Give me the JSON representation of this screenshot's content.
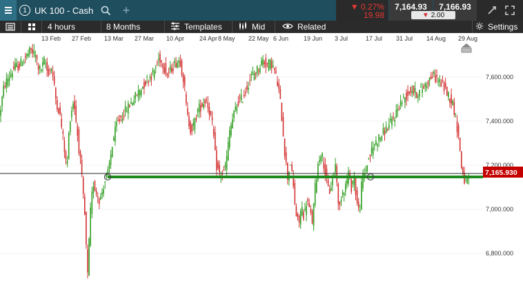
{
  "header": {
    "menu_icon": "hamburger-menu-icon",
    "instrument_number": "1",
    "instrument_name": "UK 100 - Cash",
    "search_icon": "search-icon",
    "add_icon": "plus-icon",
    "change_percent": "0.27%",
    "change_points": "19.98",
    "bid": "7,164.93",
    "offer": "7,166.93",
    "spread": "2.00"
  },
  "toolbar": {
    "grid_icon": "grid-layout-icon",
    "interval": "4 hours",
    "range": "8 Months",
    "templates": "Templates",
    "price_type": "Mid",
    "related": "Related",
    "settings": "Settings"
  },
  "chart": {
    "x_labels": [
      "13 Feb",
      "27 Feb",
      "13 Mar",
      "27 Mar",
      "10 Apr",
      "24 Apr",
      "8 May",
      "22 May",
      "6 Jun",
      "19 Jun",
      "3 Jul",
      "17 Jul",
      "31 Jul",
      "14 Aug",
      "29 Aug"
    ],
    "y_labels": [
      "7,600.000",
      "7,400.000",
      "7,200.000",
      "7,000.000",
      "6,800.000"
    ],
    "current_price_label": "7,165.930",
    "colors": {
      "up": "#2e9d1f",
      "down": "#d32f2f",
      "support": "#1e8a1e",
      "price_tag": "#c40000"
    }
  },
  "chart_data": {
    "type": "candlestick",
    "x_ticks": [
      "13 Feb",
      "27 Feb",
      "13 Mar",
      "27 Mar",
      "10 Apr",
      "24 Apr",
      "8 May",
      "22 May",
      "6 Jun",
      "19 Jun",
      "3 Jul",
      "17 Jul",
      "31 Jul",
      "14 Aug",
      "29 Aug"
    ],
    "y_ticks": [
      7600,
      7400,
      7200,
      7000,
      6800
    ],
    "ylim": [
      6770,
      7690
    ],
    "last_price": 7165.93,
    "support_level": 7145,
    "series": [
      {
        "name": "",
        "path_points": [
          [
            0,
            7410
          ],
          [
            7,
            7530
          ],
          [
            14,
            7565
          ],
          [
            22,
            7600
          ],
          [
            30,
            7610
          ],
          [
            38,
            7640
          ],
          [
            46,
            7665
          ],
          [
            52,
            7650
          ],
          [
            58,
            7590
          ],
          [
            62,
            7600
          ],
          [
            66,
            7630
          ],
          [
            70,
            7580
          ],
          [
            76,
            7600
          ],
          [
            82,
            7480
          ],
          [
            88,
            7420
          ],
          [
            94,
            7300
          ],
          [
            98,
            7210
          ],
          [
            102,
            7400
          ],
          [
            108,
            7480
          ],
          [
            112,
            7380
          ],
          [
            118,
            7230
          ],
          [
            124,
            7030
          ],
          [
            128,
            6800
          ],
          [
            132,
            7040
          ],
          [
            136,
            7160
          ],
          [
            140,
            7130
          ],
          [
            146,
            7090
          ],
          [
            152,
            7160
          ],
          [
            158,
            7200
          ],
          [
            164,
            7310
          ],
          [
            170,
            7380
          ],
          [
            176,
            7410
          ],
          [
            184,
            7440
          ],
          [
            192,
            7470
          ],
          [
            200,
            7500
          ],
          [
            208,
            7530
          ],
          [
            216,
            7560
          ],
          [
            224,
            7580
          ],
          [
            232,
            7640
          ],
          [
            238,
            7610
          ],
          [
            244,
            7570
          ],
          [
            250,
            7600
          ],
          [
            256,
            7620
          ],
          [
            262,
            7630
          ],
          [
            268,
            7540
          ],
          [
            272,
            7420
          ],
          [
            278,
            7360
          ],
          [
            282,
            7380
          ],
          [
            288,
            7440
          ],
          [
            294,
            7460
          ],
          [
            300,
            7480
          ],
          [
            306,
            7420
          ],
          [
            310,
            7360
          ],
          [
            314,
            7230
          ],
          [
            320,
            7190
          ],
          [
            326,
            7200
          ],
          [
            330,
            7260
          ],
          [
            334,
            7360
          ],
          [
            340,
            7420
          ],
          [
            346,
            7470
          ],
          [
            352,
            7480
          ],
          [
            358,
            7520
          ],
          [
            364,
            7560
          ],
          [
            370,
            7580
          ],
          [
            376,
            7600
          ],
          [
            382,
            7630
          ],
          [
            388,
            7610
          ],
          [
            394,
            7620
          ],
          [
            400,
            7580
          ],
          [
            406,
            7500
          ],
          [
            410,
            7400
          ],
          [
            414,
            7270
          ],
          [
            418,
            7180
          ],
          [
            422,
            7240
          ],
          [
            426,
            7150
          ],
          [
            430,
            7040
          ],
          [
            434,
            7000
          ],
          [
            438,
            7070
          ],
          [
            442,
            7030
          ],
          [
            446,
            7100
          ],
          [
            450,
            7050
          ],
          [
            454,
            7010
          ],
          [
            458,
            7150
          ],
          [
            462,
            7230
          ],
          [
            466,
            7280
          ],
          [
            470,
            7240
          ],
          [
            474,
            7170
          ],
          [
            478,
            7120
          ],
          [
            484,
            7180
          ],
          [
            488,
            7240
          ],
          [
            492,
            7040
          ],
          [
            496,
            7120
          ],
          [
            502,
            7150
          ],
          [
            506,
            7200
          ],
          [
            510,
            7140
          ],
          [
            514,
            7190
          ],
          [
            518,
            7090
          ],
          [
            522,
            7040
          ],
          [
            526,
            7180
          ],
          [
            530,
            7200
          ],
          [
            534,
            7240
          ],
          [
            538,
            7270
          ],
          [
            544,
            7310
          ],
          [
            550,
            7330
          ],
          [
            556,
            7350
          ],
          [
            562,
            7370
          ],
          [
            568,
            7390
          ],
          [
            574,
            7420
          ],
          [
            580,
            7460
          ],
          [
            586,
            7480
          ],
          [
            592,
            7500
          ],
          [
            598,
            7520
          ],
          [
            604,
            7500
          ],
          [
            610,
            7510
          ],
          [
            616,
            7530
          ],
          [
            622,
            7550
          ],
          [
            628,
            7570
          ],
          [
            634,
            7560
          ],
          [
            640,
            7540
          ],
          [
            646,
            7520
          ],
          [
            652,
            7490
          ],
          [
            658,
            7460
          ],
          [
            662,
            7400
          ],
          [
            666,
            7330
          ],
          [
            670,
            7220
          ],
          [
            674,
            7170
          ],
          [
            676,
            7165
          ]
        ]
      }
    ]
  }
}
